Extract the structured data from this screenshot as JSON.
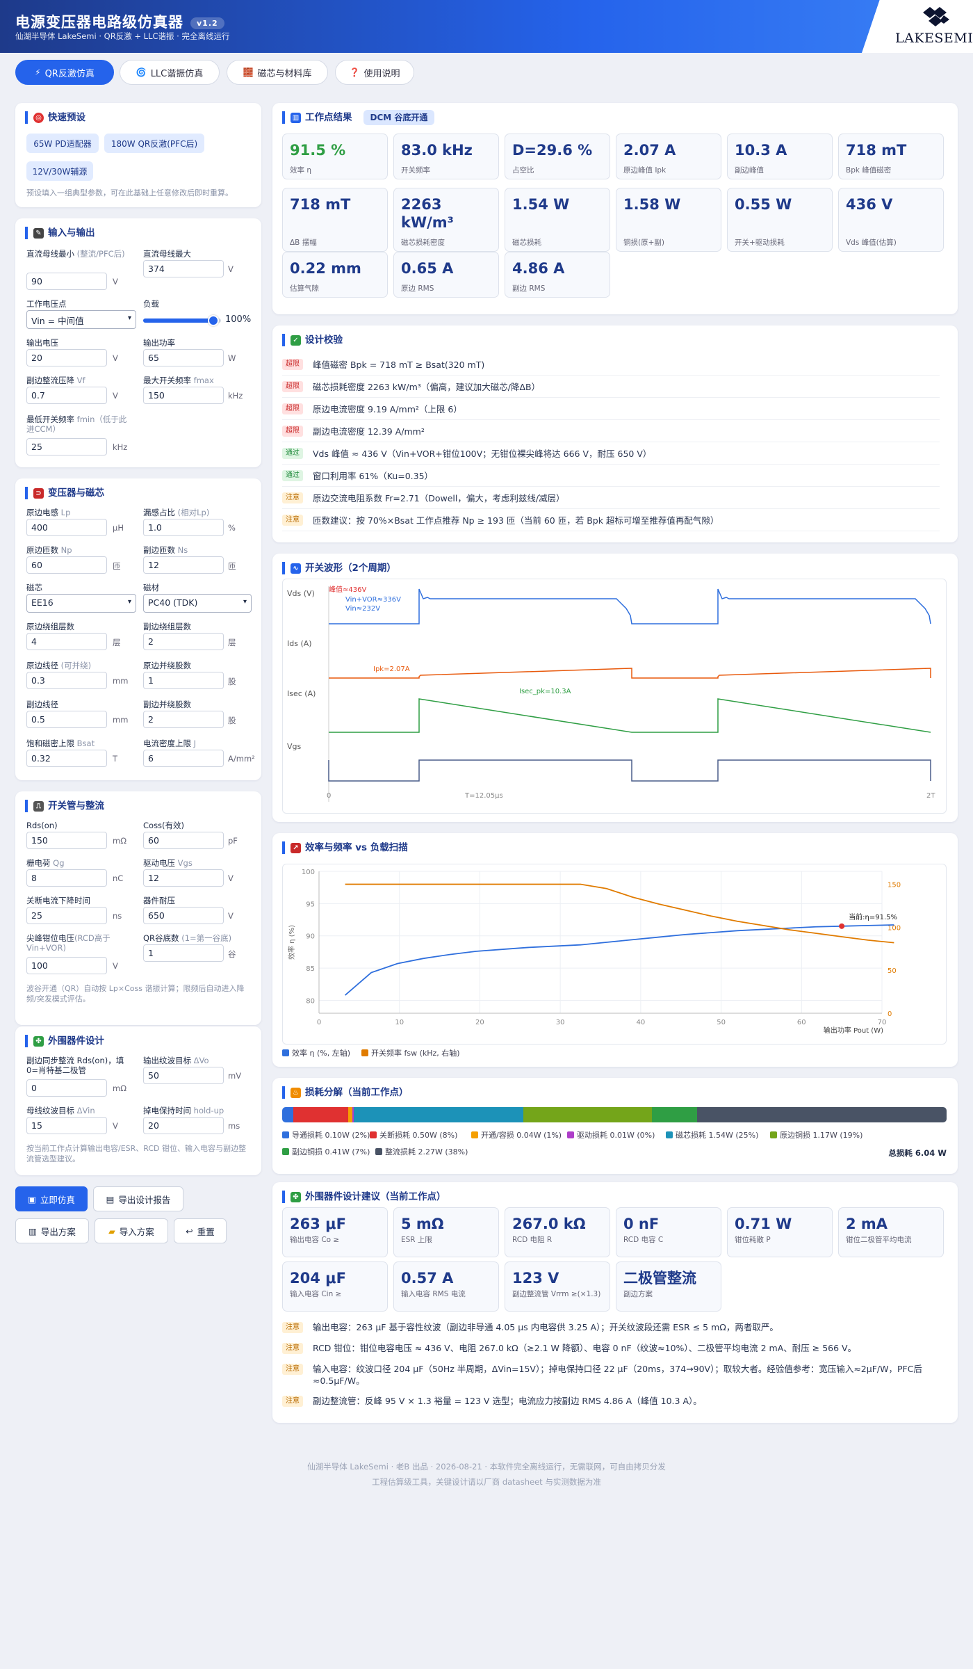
{
  "header": {
    "title": "电源变压器电路级仿真器",
    "version": "v1.2",
    "subtitle": "仙湖半导体 LakeSemi · QR反激 + LLC谐振 · 完全离线运行",
    "logo_text": "LAKESEMI"
  },
  "tabs": [
    {
      "label": "QR反激仿真",
      "icon": "⚡"
    },
    {
      "label": "LLC谐振仿真",
      "icon": "🌀"
    },
    {
      "label": "磁芯与材料库",
      "icon": "🧱"
    },
    {
      "label": "使用说明",
      "icon": "❓"
    }
  ],
  "presets": {
    "title": "快速预设",
    "items": [
      "65W PD适配器",
      "180W QR反激(PFC后)",
      "12V/30W辅源"
    ],
    "note": "预设填入一组典型参数，可在此基础上任意修改后即时重算。"
  },
  "io": {
    "title": "输入与输出",
    "vmin_label": "直流母线最小",
    "vmin_hint": "(整流/PFC后)",
    "vmin": "90",
    "vmin_unit": "V",
    "vmax_label": "直流母线最大",
    "vmax": "374",
    "vmax_unit": "V",
    "op_label": "工作电压点",
    "op_value": "Vin = 中间值",
    "load_label": "负载",
    "load_value": "100%",
    "load_fraction": 0.9,
    "vout_label": "输出电压",
    "vout": "20",
    "vout_unit": "V",
    "pout_label": "输出功率",
    "pout": "65",
    "pout_unit": "W",
    "vf_label": "副边整流压降",
    "vf_hint": "Vf",
    "vf": "0.7",
    "vf_unit": "V",
    "fmax_label": "最大开关频率",
    "fmax_hint": "fmax",
    "fmax": "150",
    "fmax_unit": "kHz",
    "fmin_label": "最低开关频率",
    "fmin_hint": "fmin（低于此进CCM）",
    "fmin": "25",
    "fmin_unit": "kHz"
  },
  "xfmr": {
    "title": "变压器与磁芯",
    "lp_label": "原边电感",
    "lp_hint": "Lp",
    "lp": "400",
    "lp_unit": "μH",
    "leak_label": "漏感占比",
    "leak_hint": "(相对Lp)",
    "leak": "1.0",
    "leak_unit": "%",
    "np_label": "原边匝数",
    "np_hint": "Np",
    "np": "60",
    "np_unit": "匝",
    "ns_label": "副边匝数",
    "ns_hint": "Ns",
    "ns": "12",
    "ns_unit": "匝",
    "core_label": "磁芯",
    "core": "EE16",
    "mat_label": "磁材",
    "mat": "PC40 (TDK)",
    "pl_label": "原边绕组层数",
    "pl": "4",
    "pl_unit": "层",
    "sl_label": "副边绕组层数",
    "sl": "2",
    "sl_unit": "层",
    "pd_label": "原边线径",
    "pd_hint": "(可并绕)",
    "pd": "0.3",
    "pd_unit": "mm",
    "ps_label": "原边并绕股数",
    "ps": "1",
    "ps_unit": "股",
    "sd_label": "副边线径",
    "sd": "0.5",
    "sd_unit": "mm",
    "ss_label": "副边并绕股数",
    "ss": "2",
    "ss_unit": "股",
    "bsat_label": "饱和磁密上限",
    "bsat_hint": "Bsat",
    "bsat": "0.32",
    "bsat_unit": "T",
    "j_label": "电流密度上限",
    "j_hint": "J",
    "j": "6",
    "j_unit": "A/mm²"
  },
  "switch": {
    "title": "开关管与整流",
    "rds_label": "Rds(on)",
    "rds": "150",
    "rds_unit": "mΩ",
    "coss_label": "Coss(有效)",
    "coss": "60",
    "coss_unit": "pF",
    "qg_label": "栅电荷",
    "qg_hint": "Qg",
    "qg": "8",
    "qg_unit": "nC",
    "vgs_label": "驱动电压",
    "vgs_hint": "Vgs",
    "vgs": "12",
    "vgs_unit": "V",
    "tf_label": "关断电流下降时间",
    "tf": "25",
    "tf_unit": "ns",
    "vds_label": "器件耐压",
    "vds": "650",
    "vds_unit": "V",
    "clamp_label": "尖峰钳位电压",
    "clamp_hint": "(RCD高于Vin+VOR)",
    "clamp": "100",
    "clamp_unit": "V",
    "qr_label": "QR谷底数",
    "qr_hint": "(1=第一谷底)",
    "qr": "1",
    "qr_unit": "谷",
    "note": "波谷开通（QR）自动按 Lp×Coss 谐振计算；限频后自动进入降频/突发模式评估。"
  },
  "periph": {
    "title": "外围器件设计",
    "rds2_label": "副边同步整流",
    "rds2_hint": "Rds(on)，填0=肖特基二极管",
    "rds2": "0",
    "rds2_unit": "mΩ",
    "dvo_label": "输出纹波目标",
    "dvo_hint": "ΔVo",
    "dvo": "50",
    "dvo_unit": "mV",
    "dvin_label": "母线纹波目标",
    "dvin_hint": "ΔVin",
    "dvin": "15",
    "dvin_unit": "V",
    "hold_label": "掉电保持时间",
    "hold_hint": "hold-up",
    "hold": "20",
    "hold_unit": "ms",
    "note": "按当前工作点计算输出电容/ESR、RCD 钳位、输入电容与副边整流管选型建议。"
  },
  "actions": {
    "simulate": "立即仿真",
    "report": "导出设计报告",
    "export": "导出方案",
    "import": "导入方案",
    "reset": "重置"
  },
  "op": {
    "title": "工作点结果",
    "mode": "DCM 谷底开通",
    "metrics": [
      {
        "v": "91.5 %",
        "l": "效率 η",
        "green": true
      },
      {
        "v": "83.0 kHz",
        "l": "开关频率"
      },
      {
        "v": "D=29.6 %",
        "l": "占空比"
      },
      {
        "v": "2.07 A",
        "l": "原边峰值 Ipk"
      },
      {
        "v": "10.3 A",
        "l": "副边峰值"
      },
      {
        "v": "718 mT",
        "l": "Bpk 峰值磁密"
      },
      {
        "v": "718 mT",
        "l": "ΔB 摆幅"
      },
      {
        "v": "2263 kW/m³",
        "l": "磁芯损耗密度"
      },
      {
        "v": "1.54 W",
        "l": "磁芯损耗"
      },
      {
        "v": "1.58 W",
        "l": "铜损(原+副)"
      },
      {
        "v": "0.55 W",
        "l": "开关+驱动损耗"
      },
      {
        "v": "436 V",
        "l": "Vds 峰值(估算)"
      },
      {
        "v": "0.22 mm",
        "l": "估算气隙"
      },
      {
        "v": "0.65 A",
        "l": "原边 RMS"
      },
      {
        "v": "4.86 A",
        "l": "副边 RMS"
      }
    ]
  },
  "check": {
    "title": "设计校验",
    "items": [
      {
        "tag": "超限",
        "c": "red",
        "t": "峰值磁密 Bpk = 718 mT ≥ Bsat(320 mT)"
      },
      {
        "tag": "超限",
        "c": "red",
        "t": "磁芯损耗密度 2263 kW/m³（偏高，建议加大磁芯/降ΔB）"
      },
      {
        "tag": "超限",
        "c": "red",
        "t": "原边电流密度 9.19 A/mm²（上限 6）"
      },
      {
        "tag": "超限",
        "c": "red",
        "t": "副边电流密度 12.39 A/mm²"
      },
      {
        "tag": "通过",
        "c": "green",
        "t": "Vds 峰值 ≈ 436 V（Vin+VOR+钳位100V；无钳位裸尖峰将达 666 V，耐压 650 V）"
      },
      {
        "tag": "通过",
        "c": "green",
        "t": "窗口利用率 61%（Ku=0.35）"
      },
      {
        "tag": "注意",
        "c": "orange",
        "t": "原边交流电阻系数 Fr=2.71（Dowell，偏大，考虑利兹线/减层）"
      },
      {
        "tag": "注意",
        "c": "orange",
        "t": "匝数建议：按 70%×Bsat 工作点推荐 Np ≥ 193 匝（当前 60 匝，若 Bpk 超标可增至推荐值再配气隙）"
      }
    ]
  },
  "wave": {
    "title": "开关波形（2个周期）",
    "labels": {
      "vds": "Vds (V)",
      "ids": "Ids (A)",
      "isec": "Isec (A)",
      "vgs": "Vgs"
    },
    "ann_peak": "峰值≈436V",
    "ann_vor": "Vin+VOR≈336V",
    "ann_vin": "Vin≈232V",
    "ann_ipk": "Ipk=2.07A",
    "ann_isec": "Isec_pk=10.3A",
    "x_start": "0",
    "x_mid": "T=12.05μs",
    "x_end": "2T"
  },
  "chart_data": {
    "type": "line",
    "title": "效率与频率 vs 负载扫描",
    "xlabel": "输出功率 Pout (W)",
    "ylabel": "效率 η (%)",
    "xlim": [
      0,
      70
    ],
    "ylim": [
      78,
      100
    ],
    "y2lim": [
      0,
      165
    ],
    "grid": true,
    "legend": "bottom-left",
    "xticks": [
      0,
      10,
      20,
      30,
      40,
      50,
      60,
      70
    ],
    "yticks": [
      80,
      85,
      90,
      95,
      100
    ],
    "y2ticks": [
      0,
      50,
      100,
      150
    ],
    "x": [
      3.25,
      6.5,
      9.75,
      13,
      16.25,
      19.5,
      22.75,
      26,
      29.25,
      32.5,
      35.75,
      39,
      42.25,
      45.5,
      48.75,
      52,
      55.25,
      58.5,
      61.75,
      65,
      68.25,
      71.5
    ],
    "series": [
      {
        "name": "效率 η (%, 左轴)",
        "axis": "left",
        "color": "#2f6fdd",
        "values": [
          80.8,
          84.3,
          85.7,
          86.5,
          87.1,
          87.6,
          87.9,
          88.2,
          88.4,
          88.6,
          89.0,
          89.4,
          89.8,
          90.2,
          90.5,
          90.8,
          91.0,
          91.2,
          91.4,
          91.5,
          91.6,
          91.7
        ]
      },
      {
        "name": "开关频率 fsw (kHz, 右轴)",
        "axis": "right",
        "color": "#e07b00",
        "values": [
          150,
          150,
          150,
          150,
          150,
          150,
          150,
          150,
          150,
          150,
          145,
          135,
          127,
          120,
          113,
          107,
          102,
          97,
          93,
          89,
          85,
          82
        ]
      }
    ],
    "marker": {
      "x": 65,
      "y": 91.5,
      "label": "当前:η=91.5%"
    }
  },
  "loss": {
    "title": "损耗分解（当前工作点）",
    "total": "总损耗 6.04 W",
    "items": [
      {
        "n": "导通损耗 0.10W (2%)",
        "v": 0.1,
        "c": "#2f6fdd"
      },
      {
        "n": "关断损耗 0.50W (8%)",
        "v": 0.5,
        "c": "#e03131"
      },
      {
        "n": "开通/容损 0.04W (1%)",
        "v": 0.04,
        "c": "#f59f00"
      },
      {
        "n": "驱动损耗 0.01W (0%)",
        "v": 0.01,
        "c": "#ae3ec9"
      },
      {
        "n": "磁芯损耗 1.54W (25%)",
        "v": 1.54,
        "c": "#1c92b8"
      },
      {
        "n": "原边铜损 1.17W (19%)",
        "v": 1.17,
        "c": "#74a51a"
      },
      {
        "n": "副边铜损 0.41W (7%)",
        "v": 0.41,
        "c": "#2f9e44"
      },
      {
        "n": "整流损耗 2.27W (38%)",
        "v": 2.27,
        "c": "#495365"
      }
    ]
  },
  "periph_out": {
    "title": "外围器件设计建议（当前工作点）",
    "metrics": [
      {
        "v": "263 μF",
        "l": "输出电容 Co ≥"
      },
      {
        "v": "5 mΩ",
        "l": "ESR 上限"
      },
      {
        "v": "267.0 kΩ",
        "l": "RCD 电阻 R"
      },
      {
        "v": "0 nF",
        "l": "RCD 电容 C"
      },
      {
        "v": "0.71 W",
        "l": "钳位耗散 P"
      },
      {
        "v": "2 mA",
        "l": "钳位二极管平均电流"
      },
      {
        "v": "204 μF",
        "l": "输入电容 Cin ≥"
      },
      {
        "v": "0.57 A",
        "l": "输入电容 RMS 电流"
      },
      {
        "v": "123 V",
        "l": "副边整流管 Vrrm ≥(×1.3)"
      },
      {
        "v": "二极管整流",
        "l": "副边方案"
      }
    ],
    "notes": [
      {
        "tag": "注意",
        "t": "输出电容：263 μF 基于容性纹波（副边非导通 4.05 μs 内电容供 3.25 A）；开关纹波段还需 ESR ≤ 5 mΩ，两者取严。"
      },
      {
        "tag": "注意",
        "t": "RCD 钳位：钳位电容电压 ≈ 436 V、电阻 267.0 kΩ（≥2.1 W 降额）、电容 0 nF（纹波≈10%）、二极管平均电流 2 mA、耐压 ≥ 566 V。"
      },
      {
        "tag": "注意",
        "t": "输入电容：纹波口径 204 μF（50Hz 半周期，ΔVin=15V）；掉电保持口径 22 μF（20ms，374→90V）；取较大者。经验值参考：宽压输入≈2μF/W，PFC后≈0.5μF/W。"
      },
      {
        "tag": "注意",
        "t": "副边整流管：反峰 95 V × 1.3 裕量 = 123 V 选型；电流应力按副边 RMS 4.86 A（峰值 10.3 A）。"
      }
    ]
  },
  "footer": {
    "line1": "仙湖半导体 LakeSemi · 老B 出品 · 2026-08-21 · 本软件完全离线运行，无需联网，可自由拷贝分发",
    "line2": "工程估算级工具，关键设计请以厂商 datasheet 与实测数据为准"
  }
}
